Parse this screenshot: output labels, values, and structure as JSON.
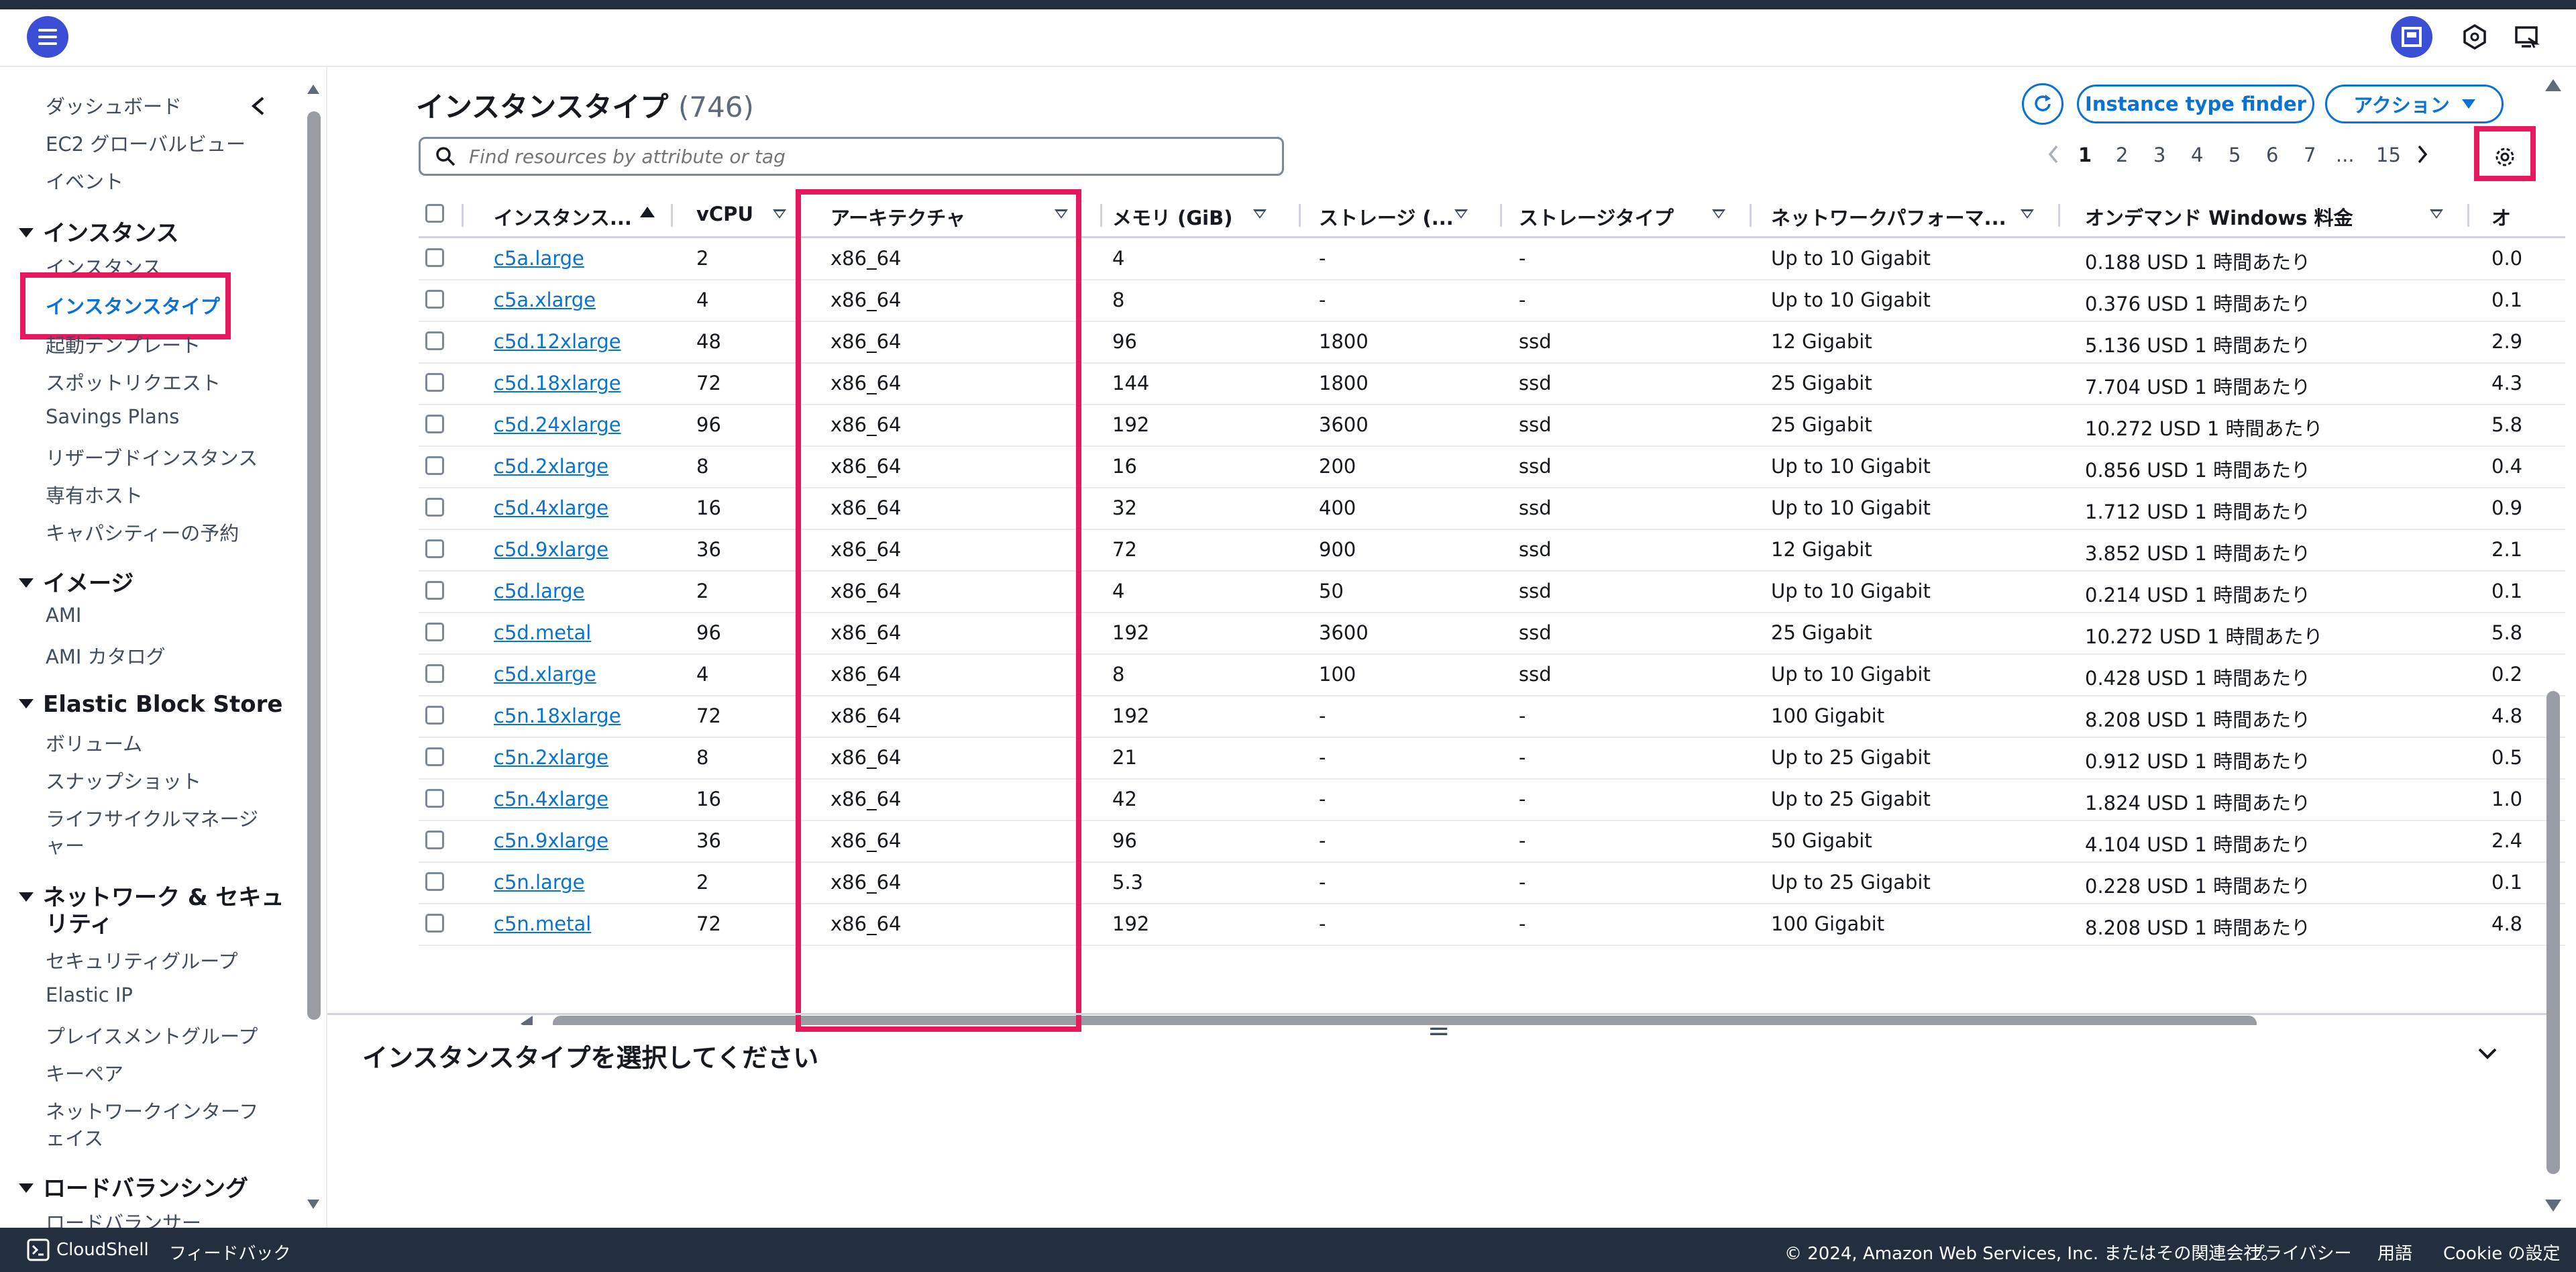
{
  "colors": {
    "accent": "#0972d3",
    "highlight": "#e8185d",
    "header_dark": "#232f3e"
  },
  "icons": {
    "menu": "menu-icon",
    "panel": "panel-icon",
    "hex": "hex-icon",
    "monitor": "monitor-icon",
    "refresh": "refresh-icon",
    "search": "search-icon",
    "gear": "gear-icon",
    "cloudshell": "cloudshell-icon"
  },
  "sidebar": {
    "items_top": [
      "ダッシュボード",
      "EC2 グローバルビュー",
      "イベント"
    ],
    "sections": [
      {
        "title": "インスタンス",
        "items": [
          "インスタンス",
          "インスタンスタイプ",
          "起動テンプレート",
          "スポットリクエスト",
          "Savings Plans",
          "リザーブドインスタンス",
          "専有ホスト",
          "キャパシティーの予約"
        ]
      },
      {
        "title": "イメージ",
        "items": [
          "AMI",
          "AMI カタログ"
        ]
      },
      {
        "title": "Elastic Block Store",
        "items": [
          "ボリューム",
          "スナップショット",
          "ライフサイクルマネージ",
          "ャー"
        ]
      },
      {
        "title": "ネットワーク & セキュ",
        "title2": "リティ",
        "items": [
          "セキュリティグループ",
          "Elastic IP",
          "プレイスメントグループ",
          "キーペア",
          "ネットワークインターフ",
          "ェイス"
        ]
      },
      {
        "title": "ロードバランシング",
        "items": [
          "ロードバランサー"
        ]
      }
    ]
  },
  "main": {
    "title": "インスタンスタイプ",
    "count": "(746)",
    "finder_label": "Instance type finder",
    "actions_label": "アクション",
    "search_placeholder": "Find resources by attribute or tag",
    "pager": [
      "1",
      "2",
      "3",
      "4",
      "5",
      "6",
      "7",
      "...",
      "15"
    ]
  },
  "table": {
    "columns": [
      "インスタンス...",
      "vCPU",
      "アーキテクチャ",
      "メモリ (GiB)",
      "ストレージ (...",
      "ストレージタイプ",
      "ネットワークパフォーマ...",
      "オンデマンド Windows 料金",
      "オ"
    ],
    "rows": [
      [
        "c5a.large",
        "2",
        "x86_64",
        "4",
        "-",
        "-",
        "Up to 10 Gigabit",
        "0.188 USD 1 時間あたり",
        "0.0"
      ],
      [
        "c5a.xlarge",
        "4",
        "x86_64",
        "8",
        "-",
        "-",
        "Up to 10 Gigabit",
        "0.376 USD 1 時間あたり",
        "0.1"
      ],
      [
        "c5d.12xlarge",
        "48",
        "x86_64",
        "96",
        "1800",
        "ssd",
        "12 Gigabit",
        "5.136 USD 1 時間あたり",
        "2.9"
      ],
      [
        "c5d.18xlarge",
        "72",
        "x86_64",
        "144",
        "1800",
        "ssd",
        "25 Gigabit",
        "7.704 USD 1 時間あたり",
        "4.3"
      ],
      [
        "c5d.24xlarge",
        "96",
        "x86_64",
        "192",
        "3600",
        "ssd",
        "25 Gigabit",
        "10.272 USD 1 時間あたり",
        "5.8"
      ],
      [
        "c5d.2xlarge",
        "8",
        "x86_64",
        "16",
        "200",
        "ssd",
        "Up to 10 Gigabit",
        "0.856 USD 1 時間あたり",
        "0.4"
      ],
      [
        "c5d.4xlarge",
        "16",
        "x86_64",
        "32",
        "400",
        "ssd",
        "Up to 10 Gigabit",
        "1.712 USD 1 時間あたり",
        "0.9"
      ],
      [
        "c5d.9xlarge",
        "36",
        "x86_64",
        "72",
        "900",
        "ssd",
        "12 Gigabit",
        "3.852 USD 1 時間あたり",
        "2.1"
      ],
      [
        "c5d.large",
        "2",
        "x86_64",
        "4",
        "50",
        "ssd",
        "Up to 10 Gigabit",
        "0.214 USD 1 時間あたり",
        "0.1"
      ],
      [
        "c5d.metal",
        "96",
        "x86_64",
        "192",
        "3600",
        "ssd",
        "25 Gigabit",
        "10.272 USD 1 時間あたり",
        "5.8"
      ],
      [
        "c5d.xlarge",
        "4",
        "x86_64",
        "8",
        "100",
        "ssd",
        "Up to 10 Gigabit",
        "0.428 USD 1 時間あたり",
        "0.2"
      ],
      [
        "c5n.18xlarge",
        "72",
        "x86_64",
        "192",
        "-",
        "-",
        "100 Gigabit",
        "8.208 USD 1 時間あたり",
        "4.8"
      ],
      [
        "c5n.2xlarge",
        "8",
        "x86_64",
        "21",
        "-",
        "-",
        "Up to 25 Gigabit",
        "0.912 USD 1 時間あたり",
        "0.5"
      ],
      [
        "c5n.4xlarge",
        "16",
        "x86_64",
        "42",
        "-",
        "-",
        "Up to 25 Gigabit",
        "1.824 USD 1 時間あたり",
        "1.0"
      ],
      [
        "c5n.9xlarge",
        "36",
        "x86_64",
        "96",
        "-",
        "-",
        "50 Gigabit",
        "4.104 USD 1 時間あたり",
        "2.4"
      ],
      [
        "c5n.large",
        "2",
        "x86_64",
        "5.3",
        "-",
        "-",
        "Up to 25 Gigabit",
        "0.228 USD 1 時間あたり",
        "0.1"
      ],
      [
        "c5n.metal",
        "72",
        "x86_64",
        "192",
        "-",
        "-",
        "100 Gigabit",
        "8.208 USD 1 時間あたり",
        "4.8"
      ]
    ]
  },
  "detail": {
    "title": "インスタンスタイプを選択してください"
  },
  "footer": {
    "cloudshell": "CloudShell",
    "feedback": "フィードバック",
    "copyright": "© 2024, Amazon Web Services, Inc. またはその関連会社。",
    "privacy": "プライバシー",
    "terms": "用語",
    "cookie": "Cookie の設定"
  }
}
